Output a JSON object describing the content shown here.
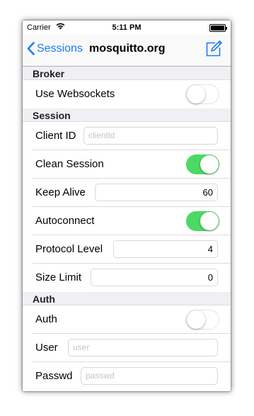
{
  "status_bar": {
    "carrier": "Carrier",
    "time": "5:11 PM"
  },
  "nav": {
    "back_label": "Sessions",
    "title": "mosquitto.org",
    "back_icon": "chevron-left-icon",
    "action_icon": "compose-icon"
  },
  "colors": {
    "accent": "#1b7cf4",
    "switch_on": "#4cd964",
    "section_bg": "#efeff4"
  },
  "sections": {
    "broker": {
      "title": "Broker",
      "use_websockets": {
        "label": "Use Websockets",
        "on": false
      }
    },
    "session": {
      "title": "Session",
      "client_id": {
        "label": "Client ID",
        "value": "",
        "placeholder": "clientid"
      },
      "clean_session": {
        "label": "Clean Session",
        "on": true
      },
      "keep_alive": {
        "label": "Keep Alive",
        "value": "60"
      },
      "autoconnect": {
        "label": "Autoconnect",
        "on": true
      },
      "protocol_level": {
        "label": "Protocol Level",
        "value": "4"
      },
      "size_limit": {
        "label": "Size Limit",
        "value": "0"
      }
    },
    "auth": {
      "title": "Auth",
      "auth": {
        "label": "Auth",
        "on": false
      },
      "user": {
        "label": "User",
        "value": "",
        "placeholder": "user"
      },
      "passwd": {
        "label": "Passwd",
        "value": "",
        "placeholder": "passwd"
      }
    }
  }
}
